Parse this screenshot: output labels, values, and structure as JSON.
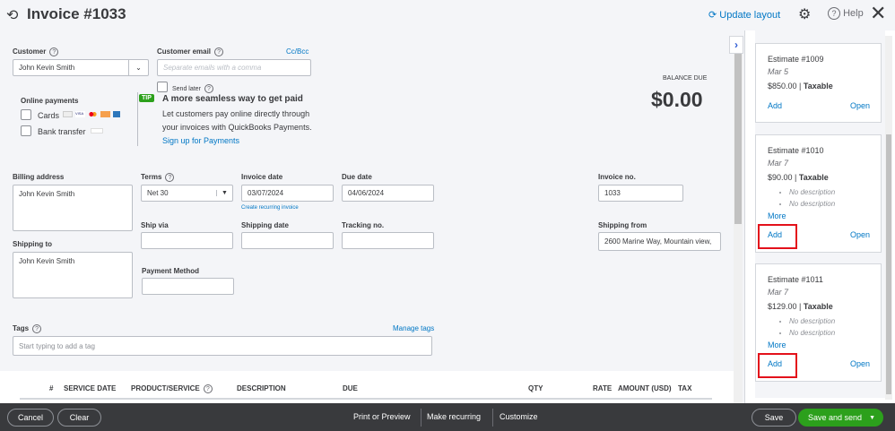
{
  "header": {
    "title": "Invoice #1033",
    "update_layout": "Update layout",
    "help": "Help"
  },
  "customer": {
    "label": "Customer",
    "value": "John Kevin Smith"
  },
  "email": {
    "label": "Customer email",
    "placeholder": "Separate emails with a comma",
    "ccbcc": "Cc/Bcc",
    "send_later": "Send later"
  },
  "online_payments": {
    "label": "Online payments",
    "cards": "Cards",
    "bank": "Bank transfer"
  },
  "tip": {
    "badge": "TIP",
    "title": "A more seamless way to get paid",
    "body1": "Let customers pay online directly through",
    "body2": "your invoices with QuickBooks Payments.",
    "link": "Sign up for Payments"
  },
  "balance": {
    "label": "BALANCE DUE",
    "value": "$0.00"
  },
  "billing": {
    "label": "Billing address",
    "value": "John Kevin Smith"
  },
  "shipping_to": {
    "label": "Shipping to",
    "value": "John Kevin Smith"
  },
  "terms": {
    "label": "Terms",
    "value": "Net 30"
  },
  "invoice_date": {
    "label": "Invoice date",
    "value": "03/07/2024",
    "recurring": "Create recurring invoice"
  },
  "due_date": {
    "label": "Due date",
    "value": "04/06/2024"
  },
  "invoice_no": {
    "label": "Invoice no.",
    "value": "1033"
  },
  "ship_via": {
    "label": "Ship via"
  },
  "shipping_date": {
    "label": "Shipping date"
  },
  "tracking": {
    "label": "Tracking no."
  },
  "shipping_from": {
    "label": "Shipping from",
    "value": "2600 Marine Way, Mountain view,"
  },
  "payment_method": {
    "label": "Payment Method"
  },
  "tags": {
    "label": "Tags",
    "manage": "Manage tags",
    "placeholder": "Start typing to add a tag"
  },
  "table": {
    "headers": [
      "#",
      "SERVICE DATE",
      "PRODUCT/SERVICE",
      "DESCRIPTION",
      "DUE",
      "QTY",
      "RATE",
      "AMOUNT (USD)",
      "TAX"
    ]
  },
  "estimates": [
    {
      "title": "Estimate #1009",
      "date": "Mar 5",
      "amount": "$850.00",
      "tax": "Taxable",
      "add": "Add",
      "open": "Open"
    },
    {
      "title": "Estimate #1010",
      "date": "Mar 7",
      "amount": "$90.00",
      "tax": "Taxable",
      "desc": [
        "No description",
        "No description"
      ],
      "more": "More",
      "add": "Add",
      "open": "Open"
    },
    {
      "title": "Estimate #1011",
      "date": "Mar 7",
      "amount": "$129.00",
      "tax": "Taxable",
      "desc": [
        "No description",
        "No description"
      ],
      "more": "More",
      "add": "Add",
      "open": "Open"
    }
  ],
  "footer": {
    "cancel": "Cancel",
    "clear": "Clear",
    "print": "Print or Preview",
    "recurring": "Make recurring",
    "customize": "Customize",
    "save": "Save",
    "save_send": "Save and send"
  }
}
